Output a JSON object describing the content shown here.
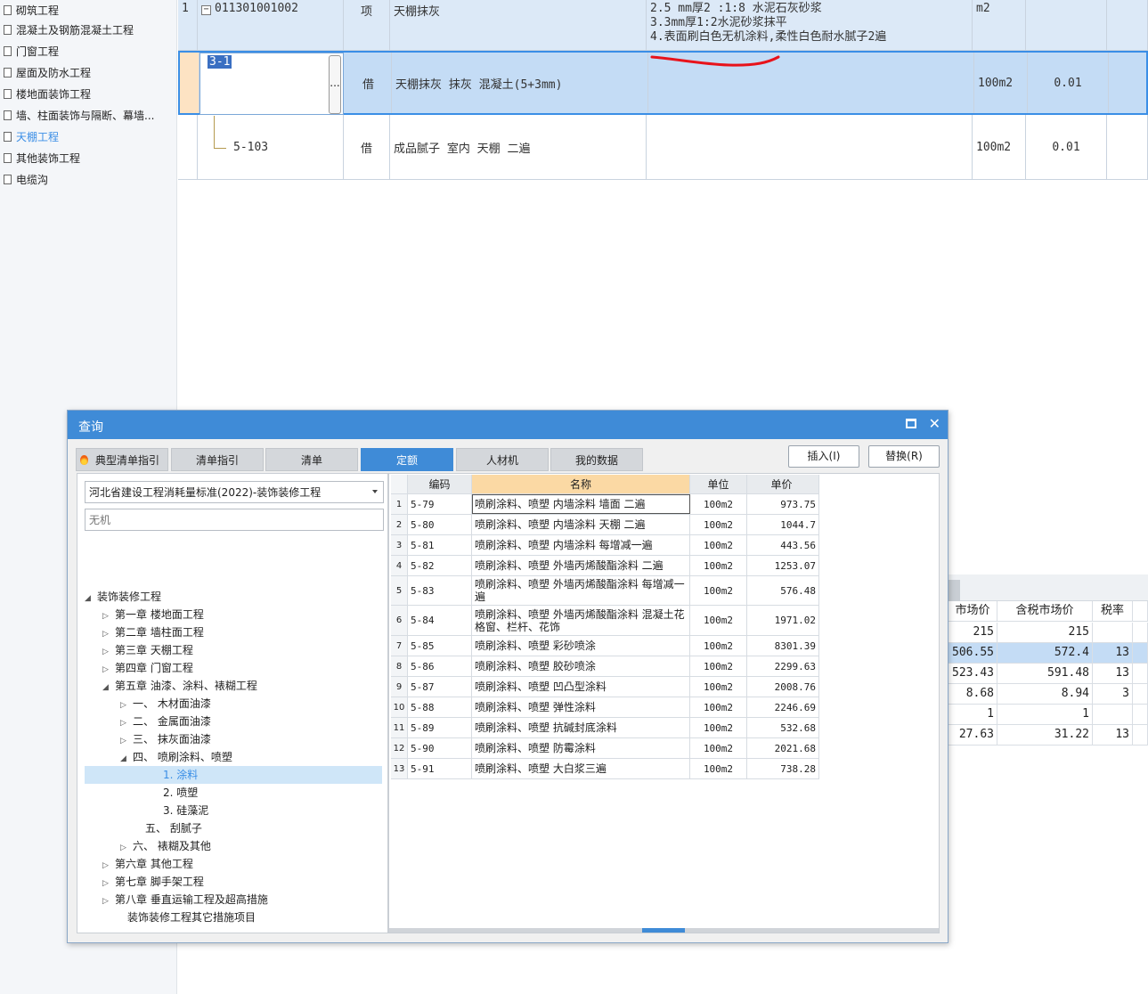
{
  "sidebar": {
    "items": [
      {
        "label": "砌筑工程"
      },
      {
        "label": "混凝土及钢筋混凝土工程"
      },
      {
        "label": "门窗工程"
      },
      {
        "label": "屋面及防水工程"
      },
      {
        "label": "楼地面装饰工程"
      },
      {
        "label": "墙、柱面装饰与隔断、幕墙..."
      },
      {
        "label": "天棚工程",
        "active": true
      },
      {
        "label": "其他装饰工程"
      },
      {
        "label": "电缆沟"
      }
    ]
  },
  "top_grid": {
    "rows": [
      {
        "num": "1",
        "code": "011301001002",
        "type": "项",
        "name": "天棚抹灰",
        "desc": [
          "2.5 mm厚2 :1:8 水泥石灰砂浆",
          "3.3mm厚1:2水泥砂浆抹平",
          "4.表面刷白色无机涂料,柔性白色耐水腻子2遍"
        ],
        "unit": "m2",
        "qty": ""
      },
      {
        "num": "",
        "code": "3-1",
        "type": "借",
        "name": "天棚抹灰 抹灰 混凝土(5+3mm)",
        "unit": "100m2",
        "qty": "0.01",
        "ellipsis": "..."
      },
      {
        "num": "",
        "code": "5-103",
        "type": "借",
        "name": "成品腻子 室内 天棚 二遍",
        "unit": "100m2",
        "qty": "0.01"
      }
    ]
  },
  "right_grid": {
    "headers": [
      "市场价",
      "含税市场价",
      "税率"
    ],
    "rows": [
      [
        "215",
        "215",
        ""
      ],
      [
        "506.55",
        "572.4",
        "13"
      ],
      [
        "523.43",
        "591.48",
        "13"
      ],
      [
        "8.68",
        "8.94",
        "3"
      ],
      [
        "1",
        "1",
        ""
      ],
      [
        "27.63",
        "31.22",
        "13"
      ]
    ]
  },
  "dialog": {
    "title": "查询",
    "tabs": [
      "典型清单指引",
      "清单指引",
      "清单",
      "定额",
      "人材机",
      "我的数据"
    ],
    "active_tab": "定额",
    "insert_label": "插入(I)",
    "replace_label": "替换(R)",
    "standard_select": "河北省建设工程消耗量标准(2022)-装饰装修工程",
    "search_placeholder": "无机",
    "tree": [
      {
        "label": "装饰装修工程",
        "arrow": "◢"
      },
      {
        "label": "第一章 楼地面工程",
        "arrow": "▷"
      },
      {
        "label": "第二章 墙柱面工程",
        "arrow": "▷"
      },
      {
        "label": "第三章 天棚工程",
        "arrow": "▷"
      },
      {
        "label": "第四章 门窗工程",
        "arrow": "▷"
      },
      {
        "label": "第五章 油漆、涂料、裱糊工程",
        "arrow": "◢"
      },
      {
        "label": "一、 木材面油漆",
        "arrow": "▷"
      },
      {
        "label": "二、 金属面油漆",
        "arrow": "▷"
      },
      {
        "label": "三、 抹灰面油漆",
        "arrow": "▷"
      },
      {
        "label": "四、 喷刷涂料、喷塑",
        "arrow": "◢"
      },
      {
        "label": "1. 涂料",
        "arrow": ""
      },
      {
        "label": "2. 喷塑",
        "arrow": ""
      },
      {
        "label": "3. 硅藻泥",
        "arrow": ""
      },
      {
        "label": "五、 刮腻子",
        "arrow": ""
      },
      {
        "label": "六、 裱糊及其他",
        "arrow": "▷"
      },
      {
        "label": "第六章 其他工程",
        "arrow": "▷"
      },
      {
        "label": "第七章 脚手架工程",
        "arrow": "▷"
      },
      {
        "label": "第八章 垂直运输工程及超高措施",
        "arrow": "▷"
      },
      {
        "label": "装饰装修工程其它措施项目",
        "arrow": ""
      }
    ],
    "table": {
      "headers": [
        "编码",
        "名称",
        "单位",
        "单价"
      ],
      "rows": [
        [
          "1",
          "5-79",
          "喷刷涂料、喷塑 内墙涂料 墙面 二遍",
          "100m2",
          "973.75"
        ],
        [
          "2",
          "5-80",
          "喷刷涂料、喷塑 内墙涂料 天棚 二遍",
          "100m2",
          "1044.7"
        ],
        [
          "3",
          "5-81",
          "喷刷涂料、喷塑 内墙涂料 每增减一遍",
          "100m2",
          "443.56"
        ],
        [
          "4",
          "5-82",
          "喷刷涂料、喷塑 外墙丙烯酸酯涂料 二遍",
          "100m2",
          "1253.07"
        ],
        [
          "5",
          "5-83",
          "喷刷涂料、喷塑 外墙丙烯酸酯涂料 每增减一遍",
          "100m2",
          "576.48"
        ],
        [
          "6",
          "5-84",
          "喷刷涂料、喷塑 外墙丙烯酸酯涂料 混凝土花格窗、栏杆、花饰",
          "100m2",
          "1971.02"
        ],
        [
          "7",
          "5-85",
          "喷刷涂料、喷塑 彩砂喷涂",
          "100m2",
          "8301.39"
        ],
        [
          "8",
          "5-86",
          "喷刷涂料、喷塑 胶砂喷涂",
          "100m2",
          "2299.63"
        ],
        [
          "9",
          "5-87",
          "喷刷涂料、喷塑 凹凸型涂料",
          "100m2",
          "2008.76"
        ],
        [
          "10",
          "5-88",
          "喷刷涂料、喷塑 弹性涂料",
          "100m2",
          "2246.69"
        ],
        [
          "11",
          "5-89",
          "喷刷涂料、喷塑 抗碱封底涂料",
          "100m2",
          "532.68"
        ],
        [
          "12",
          "5-90",
          "喷刷涂料、喷塑 防霉涂料",
          "100m2",
          "2021.68"
        ],
        [
          "13",
          "5-91",
          "喷刷涂料、喷塑 大白浆三遍",
          "100m2",
          "738.28"
        ]
      ]
    }
  },
  "colors": {
    "accent": "#3f8bd7",
    "selected_row": "#c4dcf5",
    "header_highlight": "#fbd9a4",
    "annotation": "#e8131b"
  }
}
